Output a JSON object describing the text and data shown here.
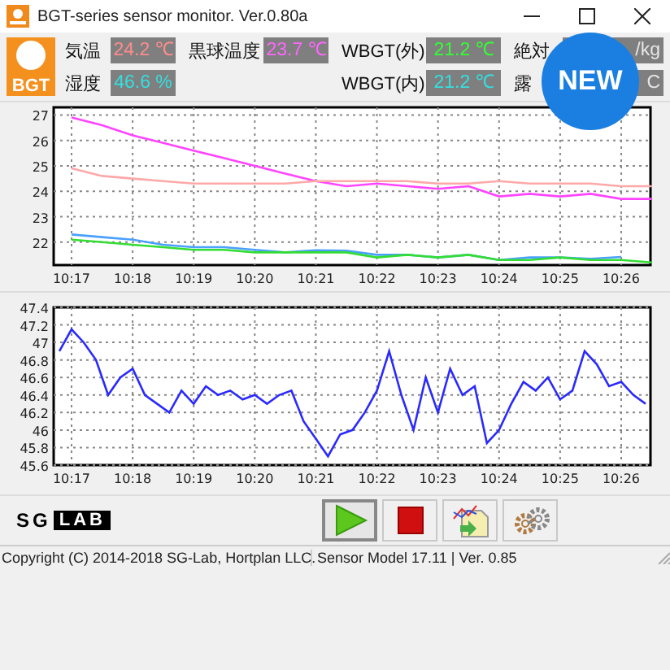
{
  "window": {
    "title": "BGT-series sensor monitor. Ver.0.80a"
  },
  "logo": {
    "text": "BGT"
  },
  "readings_top": [
    {
      "label": "気温",
      "value": "24.2 ℃",
      "color": "#ff8c8c"
    },
    {
      "label": "黒球温度",
      "value": "23.7 ℃",
      "color": "#ff66ff"
    },
    {
      "label": "WBGT(外)",
      "value": "21.2 ℃",
      "color": "#33ff33"
    },
    {
      "label": "絶対",
      "value": "/kg",
      "color": "#e6e6e6"
    }
  ],
  "readings_bottom": [
    {
      "label": "湿度",
      "value": "46.6 %",
      "color": "#33e0e0"
    },
    {
      "label": "WBGT(内)",
      "value": "21.2 ℃",
      "color": "#33e0e0"
    },
    {
      "label": "露",
      "value": "C",
      "color": "#e6e6e6"
    }
  ],
  "badge": {
    "text": "NEW"
  },
  "charts": [
    {
      "chart_data": {
        "type": "line",
        "categories": [
          null,
          "10:17",
          null,
          "10:18",
          null,
          "10:19",
          null,
          "10:20",
          null,
          "10:21",
          null,
          "10:22",
          null,
          "10:23",
          null,
          "10:24",
          null,
          "10:25",
          null,
          "10:26",
          null
        ],
        "yticks": [
          22,
          23,
          24,
          25,
          26,
          27
        ],
        "ylim": [
          21.1,
          27.3
        ],
        "grid": true,
        "series": [
          {
            "color": "#ff44ff",
            "values": [
              null,
              26.9,
              26.6,
              26.2,
              25.9,
              25.6,
              25.3,
              25.0,
              24.7,
              24.4,
              24.2,
              24.3,
              24.2,
              24.1,
              24.2,
              23.8,
              23.9,
              23.8,
              23.9,
              23.7,
              23.7
            ]
          },
          {
            "color": "#ffa8a8",
            "values": [
              null,
              24.9,
              24.6,
              24.5,
              24.4,
              24.3,
              24.3,
              24.3,
              24.3,
              24.4,
              24.4,
              24.4,
              24.4,
              24.3,
              24.3,
              24.4,
              24.3,
              24.3,
              24.3,
              24.2,
              24.2
            ]
          },
          {
            "color": "#4aa0ff",
            "values": [
              null,
              22.3,
              22.2,
              22.1,
              21.9,
              21.8,
              21.8,
              21.7,
              21.6,
              21.68,
              21.66,
              21.5,
              21.5,
              21.4,
              21.5,
              21.3,
              21.4,
              21.4,
              21.35,
              21.42,
              null
            ]
          },
          {
            "color": "#33dd33",
            "values": [
              null,
              22.1,
              22.0,
              21.9,
              21.8,
              21.7,
              21.7,
              21.6,
              21.6,
              21.6,
              21.6,
              21.4,
              21.5,
              21.4,
              21.5,
              21.3,
              21.3,
              21.4,
              21.3,
              21.3,
              21.2
            ]
          }
        ]
      }
    },
    {
      "chart_data": {
        "type": "line",
        "categories": [
          null,
          null,
          "10:17",
          null,
          null,
          null,
          null,
          "10:18",
          null,
          null,
          null,
          null,
          "10:19",
          null,
          null,
          null,
          null,
          "10:20",
          null,
          null,
          null,
          null,
          "10:21",
          null,
          null,
          null,
          null,
          "10:22",
          null,
          null,
          null,
          null,
          "10:23",
          null,
          null,
          null,
          null,
          "10:24",
          null,
          null,
          null,
          null,
          "10:25",
          null,
          null,
          null,
          null,
          "10:26",
          null,
          null
        ],
        "yticks": [
          {
            "value": 45.6,
            "label": "45.6"
          },
          {
            "value": 45.8,
            "label": "45.8"
          },
          {
            "value": 46,
            "label": "46"
          },
          {
            "value": 46.2,
            "label": "46.2"
          },
          {
            "value": 46.4,
            "label": "46.4"
          },
          {
            "value": 46.6,
            "label": "46.6"
          },
          {
            "value": 46.8,
            "label": "46.8"
          },
          {
            "value": 47,
            "label": "47"
          },
          {
            "value": 47.2,
            "label": "47.2"
          },
          {
            "value": 47.4,
            "label": "47.4"
          }
        ],
        "ylim": [
          45.6,
          47.4
        ],
        "grid": true,
        "series": [
          {
            "color": "#2a2aff",
            "values": [
              null,
              46.9,
              47.15,
              47.0,
              46.8,
              46.4,
              46.6,
              46.7,
              46.4,
              46.3,
              46.2,
              46.45,
              46.3,
              46.5,
              46.4,
              46.45,
              46.35,
              46.4,
              46.3,
              46.4,
              46.45,
              46.1,
              45.9,
              45.7,
              45.95,
              46.0,
              46.2,
              46.45,
              46.9,
              46.4,
              46.0,
              46.6,
              46.2,
              46.7,
              46.4,
              46.5,
              45.85,
              46.0,
              46.3,
              46.55,
              46.45,
              46.6,
              46.35,
              46.45,
              46.9,
              46.75,
              46.5,
              46.55,
              46.4,
              46.3
            ]
          }
        ]
      }
    }
  ],
  "toolbar": [
    {
      "kind": "play",
      "pressed": true
    },
    {
      "kind": "stop",
      "pressed": false
    },
    {
      "kind": "export",
      "pressed": false
    },
    {
      "kind": "settings",
      "pressed": false
    }
  ],
  "brand": {
    "part_1": "SG",
    "part_2": "LAB"
  },
  "status_bar": [
    "Copyright (C) 2014-2018 SG-Lab, Hortplan LLC.",
    "Sensor Model 17.11 | Ver. 0.85"
  ]
}
